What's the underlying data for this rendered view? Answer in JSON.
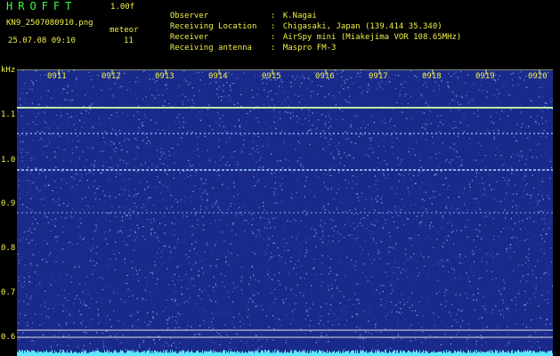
{
  "header": {
    "app_title": "HROFFT",
    "version": "1.00f",
    "file_name": "KN9_2507080910.png",
    "mode": "meteor",
    "datetime": "25.07.08 09:10",
    "count": "11"
  },
  "info": [
    {
      "label": "Observer",
      "value": "K.Nagai"
    },
    {
      "label": "Receiving Location",
      "value": "Chigasaki, Japan (139.414 35.340)"
    },
    {
      "label": "Receiver",
      "value": "AirSpy mini (Miakejima VOR 108.65MHz)"
    },
    {
      "label": "Receiving antenna",
      "value": "Maspro FM-3"
    }
  ],
  "axis": {
    "unit": "kHz",
    "y_ticks": [
      "1.1",
      "1.0",
      "0.9",
      "0.8",
      "0.7",
      "0.6"
    ],
    "x_ticks": [
      "0911",
      "0912",
      "0913",
      "0914",
      "0915",
      "0916",
      "0917",
      "0918",
      "0919",
      "0920"
    ]
  },
  "colors": {
    "background": "#000000",
    "spectrogram": "#1a2a8a",
    "label_yellow": "#f0f048",
    "title_green": "#3cff3c",
    "trace_cyan": "#5ee8ff"
  }
}
